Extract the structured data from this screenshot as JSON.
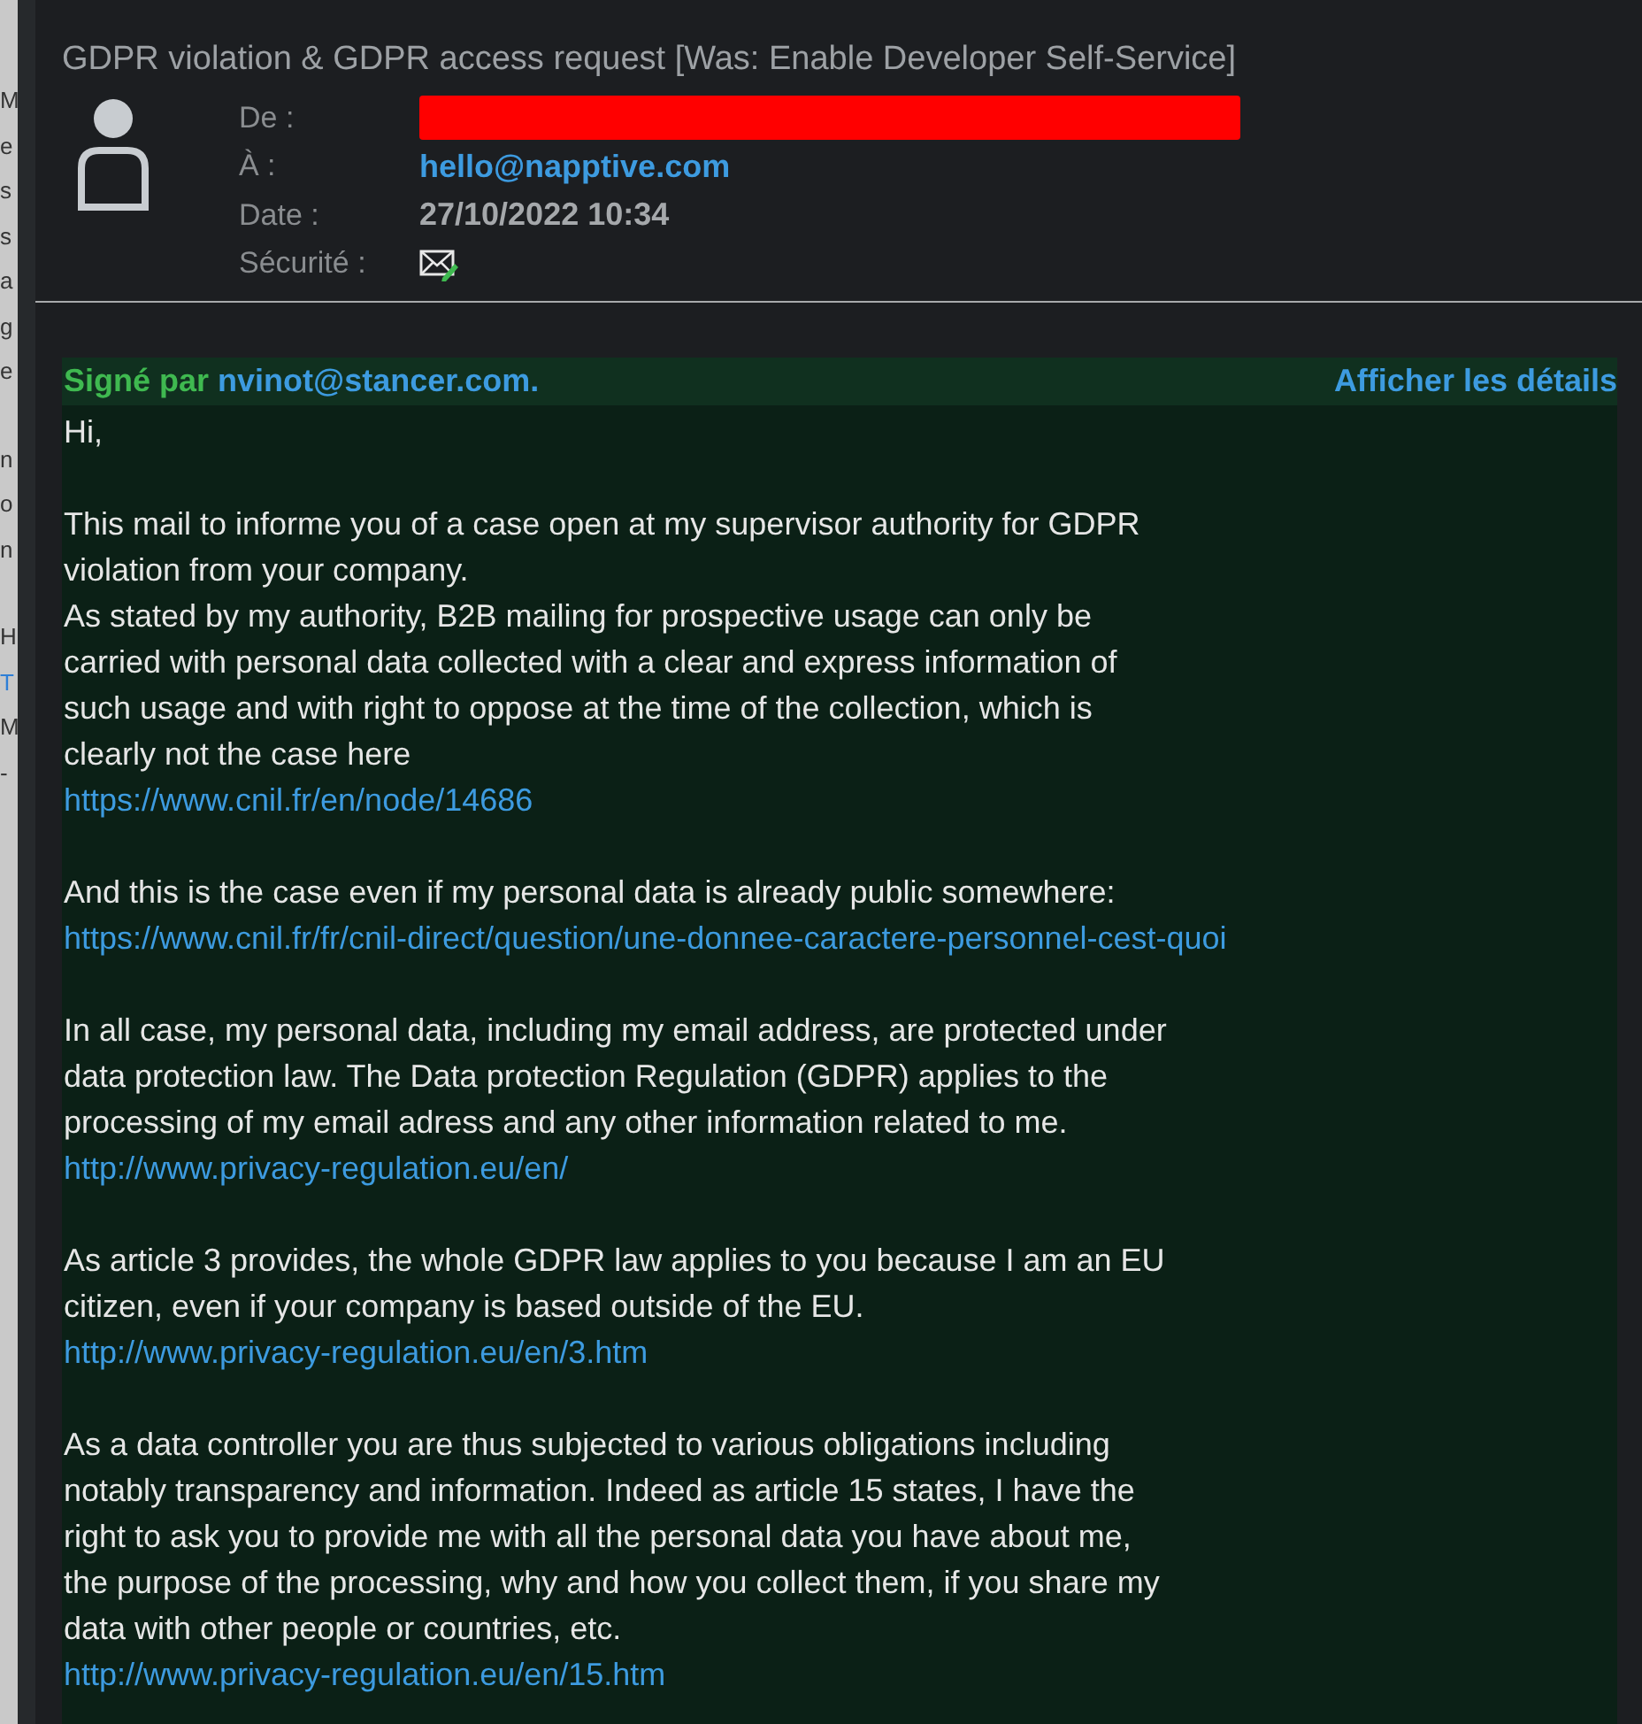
{
  "left_strip": [
    {
      "letters": [
        {
          "text": "M",
          "link": false
        },
        {
          "text": "e",
          "link": false
        },
        {
          "text": "s",
          "link": false
        },
        {
          "text": "s",
          "link": false
        },
        {
          "text": "a",
          "link": false
        },
        {
          "text": "g",
          "link": false
        },
        {
          "text": "e",
          "link": false
        }
      ]
    },
    {
      "letters": [
        {
          "text": "n",
          "link": false
        },
        {
          "text": "o",
          "link": false
        },
        {
          "text": "n",
          "link": false
        }
      ]
    },
    {
      "letters": [
        {
          "text": "H",
          "link": false
        },
        {
          "text": "T",
          "link": true
        },
        {
          "text": "M",
          "link": false
        },
        {
          "text": "-",
          "link": false
        }
      ]
    }
  ],
  "message": {
    "subject": "GDPR violation & GDPR access request [Was: Enable Developer Self-Service]",
    "headers": [
      {
        "kind": "redacted",
        "label": "De :"
      },
      {
        "kind": "address",
        "label": "À :",
        "value": "hello@napptive.com"
      },
      {
        "kind": "date",
        "label": "Date :",
        "value": "27/10/2022 10:34"
      },
      {
        "kind": "security",
        "label": "Sécurité :"
      }
    ],
    "signature": {
      "prefix": "Signé par",
      "signer": "nvinot@stancer.com.",
      "details_link": "Afficher les détails"
    },
    "body": [
      {
        "text": "Hi,"
      },
      {
        "text": "This mail to informe you of a case open at my supervisor authority for GDPR\nviolation from your company.\nAs stated by my authority, B2B mailing for prospective usage can only be\ncarried with personal data collected with a clear and express information of\nsuch usage and with right to oppose at the time of the collection, which is\nclearly not the case here",
        "link": "https://www.cnil.fr/en/node/14686"
      },
      {
        "text": "And this is the case even if my personal data is already public somewhere:",
        "link": "https://www.cnil.fr/fr/cnil-direct/question/une-donnee-caractere-personnel-cest-quoi"
      },
      {
        "text": "In all case, my personal data, including my email address, are protected under\ndata protection law. The Data protection Regulation (GDPR) applies to the\nprocessing of my email adress and any other information related to me.",
        "link": "http://www.privacy-regulation.eu/en/"
      },
      {
        "text": "As article 3 provides, the whole GDPR law applies to you because I am an EU\ncitizen, even if your company is based outside of the EU.",
        "link": "http://www.privacy-regulation.eu/en/3.htm"
      },
      {
        "text": "As a data controller you are thus subjected to various obligations including\nnotably transparency and information. Indeed as article 15 states, I have the\nright to ask you to provide me with all the personal data you have about me,\nthe purpose of the processing, why and how you collect them, if you share my\ndata with other people or countries, etc.",
        "link": "http://www.privacy-regulation.eu/en/15.htm"
      }
    ]
  }
}
